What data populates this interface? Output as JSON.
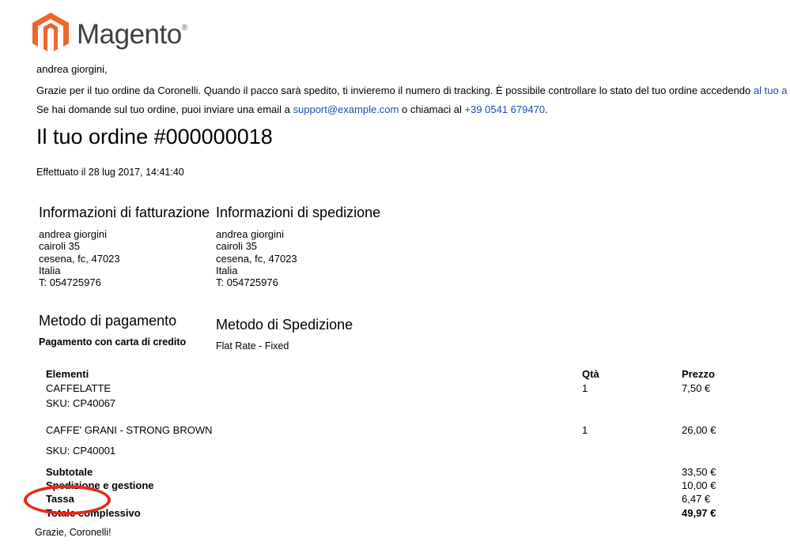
{
  "brand": {
    "name": "Magento",
    "reg": "®",
    "logo_color": "#ee672b"
  },
  "email": {
    "greeting": "andrea giorgini,",
    "intro_text": "Grazie per il tuo ordine da Coronelli. Quando il pacco sarà spedito, ti invieremo il numero di tracking. È possibile controllare lo stato del tuo ordine accedendo ",
    "intro_link": "al tuo a",
    "contact_prefix": "Se hai domande sul tuo ordine, puoi inviare una email a ",
    "contact_email": "support@example.com",
    "contact_middle": " o chiamaci al ",
    "contact_phone": "+39 0541 679470",
    "contact_suffix": ".",
    "order_title": "Il tuo ordine #000000018",
    "placed_on": "Effettuato il 28 lug 2017, 14:41:40",
    "billing": {
      "title": "Informazioni di fatturazione",
      "lines": [
        "andrea giorgini",
        "cairoli 35",
        "cesena, fc, 47023",
        "Italia",
        "T: 054725976"
      ]
    },
    "shipping": {
      "title": "Informazioni di spedizione",
      "lines": [
        "andrea giorgini",
        "cairoli 35",
        "cesena, fc, 47023",
        "Italia",
        "T: 054725976"
      ]
    },
    "payment": {
      "title": "Metodo di pagamento",
      "value": "Pagamento con carta di credito"
    },
    "shipping_method": {
      "title": "Metodo di Spedizione",
      "value": "Flat Rate - Fixed"
    },
    "items_table": {
      "headers": {
        "item": "Elementi",
        "qty": "Qtà",
        "price": "Prezzo"
      },
      "rows": [
        {
          "name": "CAFFELATTE",
          "qty": "1",
          "price": "7,50 €",
          "sku": "SKU: CP40067"
        },
        {
          "name": "CAFFE' GRANI - STRONG BROWN",
          "qty": "1",
          "price": "26,00 €",
          "sku": "SKU: CP40001"
        }
      ]
    },
    "totals": [
      {
        "label": "Subtotale",
        "value": "33,50 €"
      },
      {
        "label": "Spedizione e gestione",
        "value": "10,00 €"
      },
      {
        "label": "Tassa",
        "value": "6,47 €"
      },
      {
        "label": "Totale complessivo",
        "value": "49,97 €"
      }
    ],
    "signoff": "Grazie, Coronelli!"
  },
  "annotation": {
    "color": "#e8271a"
  }
}
